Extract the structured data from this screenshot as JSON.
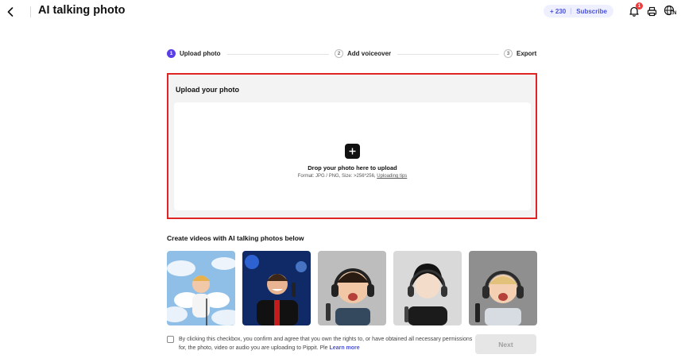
{
  "header": {
    "title": "AI talking photo",
    "credits": "+ 230",
    "subscribe_label": "Subscribe",
    "notification_count": "1",
    "language_label": "EN"
  },
  "stepper": {
    "steps": [
      {
        "number": "1",
        "label": "Upload photo",
        "active": true
      },
      {
        "number": "2",
        "label": "Add voiceover",
        "active": false
      },
      {
        "number": "3",
        "label": "Export",
        "active": false
      }
    ]
  },
  "upload": {
    "title": "Upload your photo",
    "drop_text": "Drop your photo here to upload",
    "format_text": "Format: JPG / PNG, Size: >256*256,",
    "tips_link": "Uploading tips"
  },
  "samples": {
    "title": "Create videos with AI talking photos below",
    "items": [
      {
        "icon": "angel-baby-photo"
      },
      {
        "icon": "singer-with-microphone-photo"
      },
      {
        "icon": "baby-with-headphones-photo"
      },
      {
        "icon": "anime-man-with-headphones-photo"
      },
      {
        "icon": "toddler-with-headphones-photo"
      }
    ]
  },
  "footer": {
    "consent_text": "By clicking this checkbox, you confirm and agree that you own the rights to, or have obtained all necessary permissions for, the photo, video or audio you are uploading to Pippit. Ple",
    "learn_more": "Learn more",
    "next_label": "Next"
  },
  "colors": {
    "accent": "#5a3ee8",
    "highlight_border": "#e02424",
    "link": "#4b53d6"
  }
}
